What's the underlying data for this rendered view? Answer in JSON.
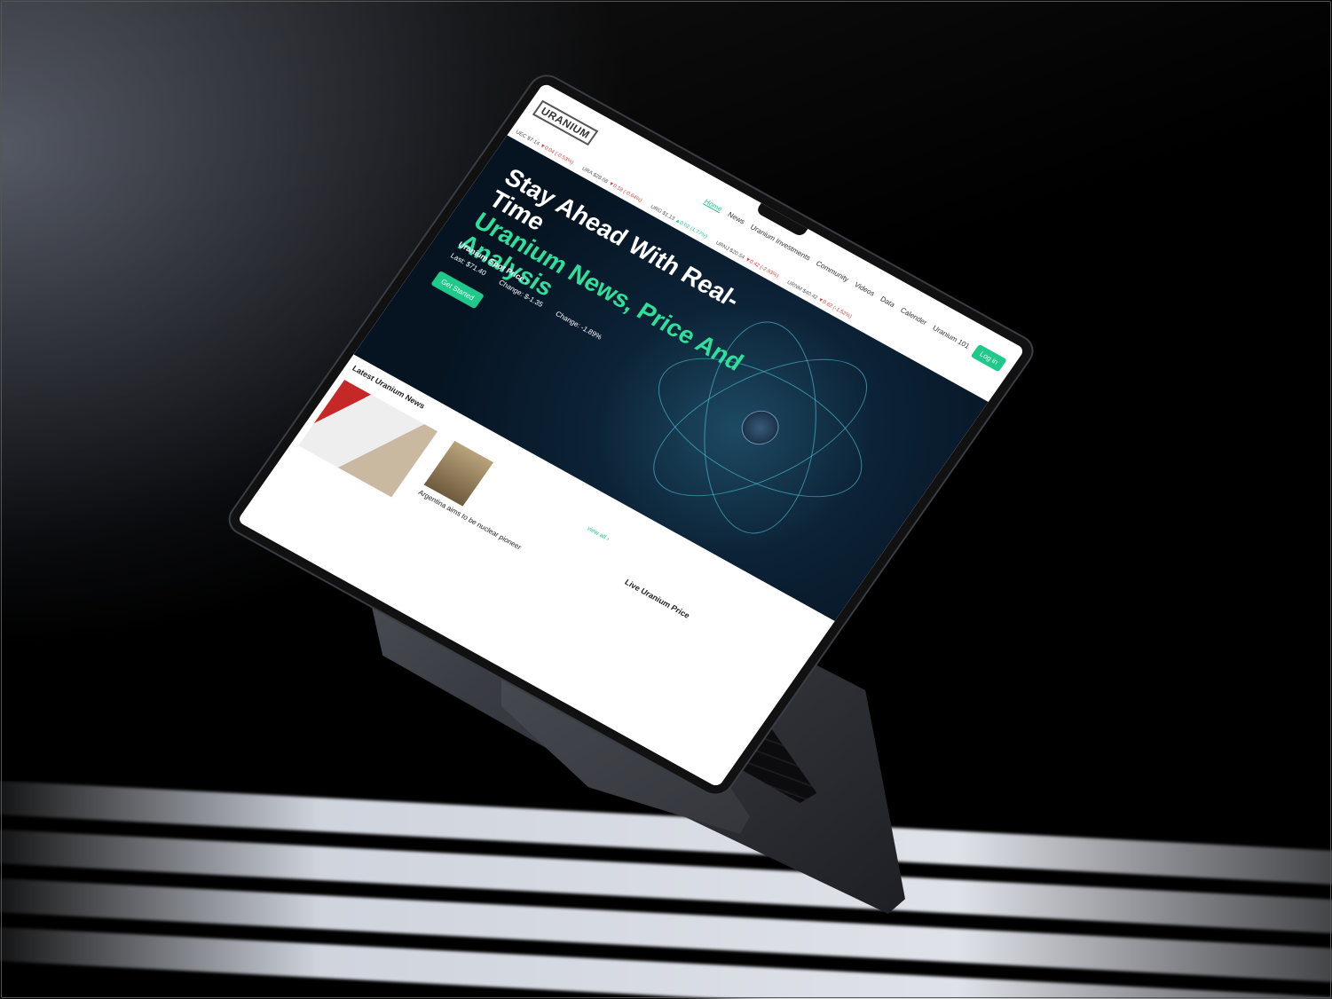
{
  "header": {
    "logo_text": "URANIUM",
    "nav": [
      "Home",
      "News",
      "Uranium Investments",
      "Community",
      "Videos",
      "Data",
      "Calender",
      "Uranium 101"
    ],
    "active_nav": "Home",
    "login_label": "Log in"
  },
  "ticker": [
    {
      "label": "UEC $7.14",
      "change": "▼0.04 (-0.53%)",
      "dir": "down"
    },
    {
      "label": "URA $28.08",
      "change": "▼0.18 (-0.64%)",
      "dir": "down"
    },
    {
      "label": "URG $1.13",
      "change": "▲0.02 (1.77%)",
      "dir": "up"
    },
    {
      "label": "URNJ $20.54",
      "change": "▼0.42 (-2.93%)",
      "dir": "down"
    },
    {
      "label": "URNM $40.42",
      "change": "▼0.62 (-1.52%)",
      "dir": "down"
    }
  ],
  "hero": {
    "headline_white": "Stay Ahead With Real-Time",
    "headline_green": "Uranium News, Price And Analysis",
    "spot_label": "Uranium Spot Price :",
    "last": "Last: $71.40",
    "change_abs": "Change: $-1.35",
    "change_pct": "Change: -1.89%",
    "cta_label": "Get Started"
  },
  "news": {
    "section_title": "Latest Uranium News",
    "view_all": "view all",
    "headline": "Argentina aims to be nuclear pioneer"
  },
  "price": {
    "section_title": "Live Uranium Price"
  },
  "colors": {
    "accent": "#1ec98a",
    "hero_bg": "#061422",
    "down": "#e23b3b"
  }
}
